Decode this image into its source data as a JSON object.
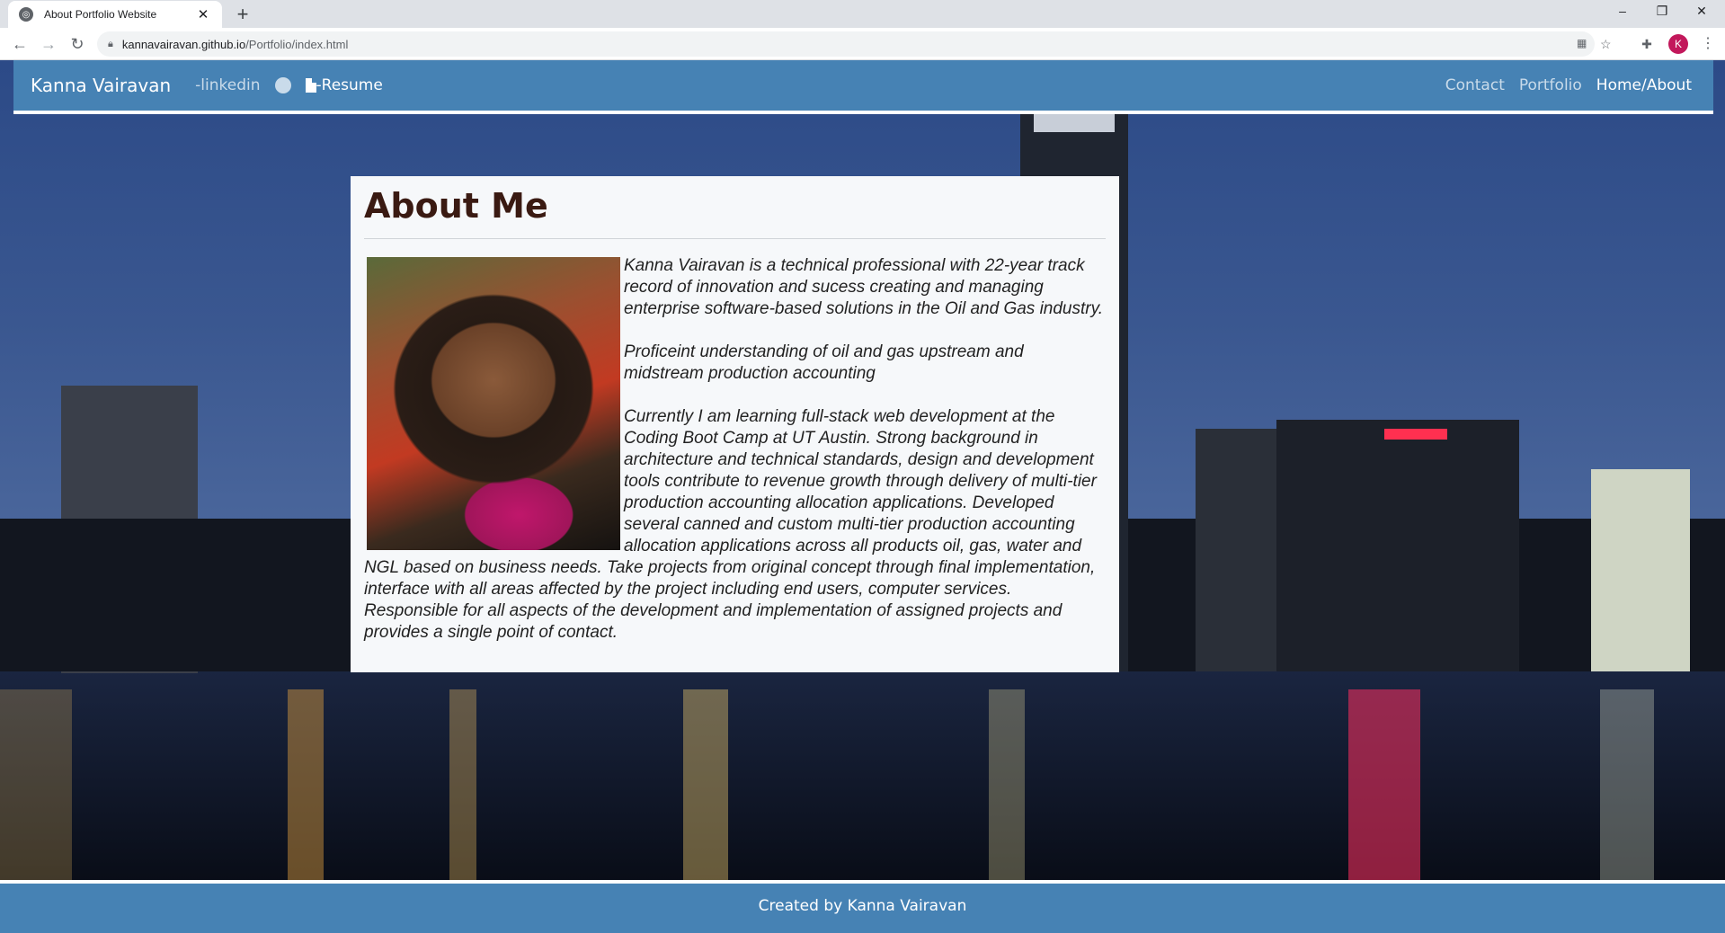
{
  "browser": {
    "tab_title": "About Portfolio Website",
    "url_host": "kannavairavan.github.io",
    "url_path": "/Portfolio/index.html",
    "profile_initial": "K",
    "icons": [
      "globe-icon",
      "close-icon",
      "plus-icon",
      "back-icon",
      "forward-icon",
      "reload-icon",
      "lock-icon",
      "qr-icon",
      "star-icon",
      "puzzle-icon",
      "menu-icon"
    ]
  },
  "navbar": {
    "brand": "Kanna Vairavan",
    "linkedin": "-linkedin",
    "resume": "-Resume",
    "links": [
      "Contact",
      "Portfolio",
      "Home/About"
    ]
  },
  "about": {
    "title": "About Me",
    "paragraphs": [
      "Kanna Vairavan is a technical professional with 22-year track record of innovation and sucess creating and managing enterprise software-based solutions in the Oil and Gas industry.",
      "Proficeint understanding of oil and gas upstream and midstream production accounting",
      "Currently I am learning full-stack web development at the Coding Boot Camp at UT Austin. Strong background in architecture and technical standards, design and development tools contribute to revenue growth through delivery of multi-tier production accounting allocation applications. Developed several canned and custom multi-tier production accounting allocation applications across all products oil, gas, water and NGL based on business needs. Take projects from original concept through final implementation, interface with all areas affected by the project including end users, computer services. Responsible for all aspects of the development and implementation of assigned projects and provides a single point of contact."
    ]
  },
  "footer": {
    "text": "Created by Kanna Vairavan"
  },
  "colors": {
    "navbar": "#4682b4",
    "card": "#f6f8fa",
    "title": "#3a1a12"
  }
}
